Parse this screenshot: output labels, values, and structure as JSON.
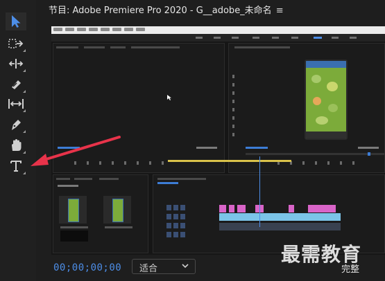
{
  "window": {
    "title": "节目: Adobe Premiere Pro 2020 - G__adobe_未命名",
    "menu_glyph": "≡"
  },
  "tools": [
    {
      "name": "selection-tool",
      "icon": "arrow-cursor-icon",
      "active": true
    },
    {
      "name": "track-select-tool",
      "icon": "track-select-icon"
    },
    {
      "name": "ripple-edit-tool",
      "icon": "ripple-edit-icon"
    },
    {
      "name": "razor-tool",
      "icon": "razor-icon"
    },
    {
      "name": "slip-tool",
      "icon": "slip-icon"
    },
    {
      "name": "pen-tool",
      "icon": "pen-icon"
    },
    {
      "name": "hand-tool",
      "icon": "hand-icon"
    },
    {
      "name": "type-tool",
      "icon": "type-T-icon"
    }
  ],
  "footer": {
    "timecode": "00;00;00;00",
    "fit_select": {
      "selected": "适合"
    },
    "complete_label": "完整"
  },
  "watermark": "最需教育",
  "colors": {
    "accent_blue": "#4d8ee8",
    "annotation_arrow": "#e8334a",
    "clip_pink": "#d964c8",
    "clip_audio": "#7bc4e8"
  }
}
